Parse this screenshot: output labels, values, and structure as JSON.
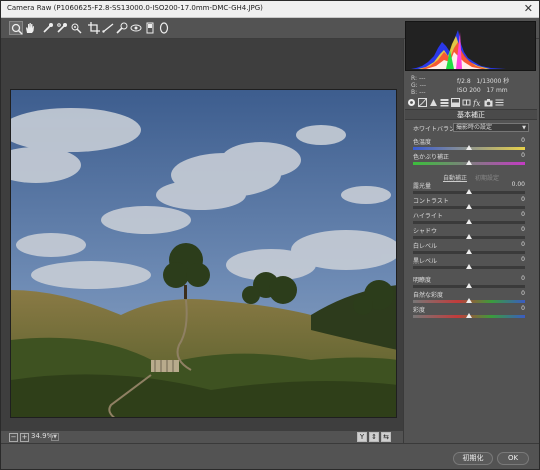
{
  "window": {
    "title": "Camera Raw (P1060625-F2.8-SS13000.0-ISO200-17.0mm-DMC-GH4.JPG)",
    "close_glyph": "✕"
  },
  "toolbar": {
    "tools": [
      "zoom-icon",
      "hand-icon",
      "white-balance-icon",
      "color-sampler-icon",
      "targeted-adjust-icon",
      "crop-icon",
      "straighten-icon",
      "spot-removal-icon",
      "red-eye-icon",
      "graduated-filter-icon",
      "radial-filter-icon"
    ],
    "fullscreen_icon": "fullscreen-icon"
  },
  "info": {
    "r_label": "R:",
    "g_label": "G:",
    "b_label": "B:",
    "r_value": "---",
    "g_value": "---",
    "b_value": "---",
    "aperture": "f/2.8",
    "shutter": "1/13000 秒",
    "iso": "ISO 200",
    "focal": "17 mm"
  },
  "panel": {
    "section_title": "基本補正",
    "white_balance_label": "ホワイトバランス：",
    "white_balance_value": "撮影時の設定",
    "auto_link": "自動補正",
    "default_link": "初期設定",
    "sliders": [
      {
        "label": "色温度",
        "value": "0",
        "pos": 0.5,
        "grad": "temp"
      },
      {
        "label": "色かぶり補正",
        "value": "0",
        "pos": 0.5,
        "grad": "tint"
      },
      {
        "label": "露光量",
        "value": "0.00",
        "pos": 0.5,
        "grad": "none"
      },
      {
        "label": "コントラスト",
        "value": "0",
        "pos": 0.5,
        "grad": "none"
      },
      {
        "label": "ハイライト",
        "value": "0",
        "pos": 0.5,
        "grad": "none"
      },
      {
        "label": "シャドウ",
        "value": "0",
        "pos": 0.5,
        "grad": "none"
      },
      {
        "label": "白レベル",
        "value": "0",
        "pos": 0.5,
        "grad": "none"
      },
      {
        "label": "黒レベル",
        "value": "0",
        "pos": 0.5,
        "grad": "none"
      },
      {
        "label": "明瞭度",
        "value": "0",
        "pos": 0.5,
        "grad": "none"
      },
      {
        "label": "自然な彩度",
        "value": "0",
        "pos": 0.5,
        "grad": "sat"
      },
      {
        "label": "彩度",
        "value": "0",
        "pos": 0.5,
        "grad": "sat"
      }
    ]
  },
  "statusbar": {
    "zoom_minus": "−",
    "zoom_plus": "+",
    "zoom_value": "34.9%",
    "view_y": "Y",
    "view_compare": "⇕",
    "view_swap": "⇆"
  },
  "footer": {
    "reset_label": "初期化",
    "ok_label": "OK"
  },
  "colors": {
    "panel_bg": "#535353",
    "canvas_bg": "#3e3e3e",
    "histogram_bg": "#222222"
  }
}
